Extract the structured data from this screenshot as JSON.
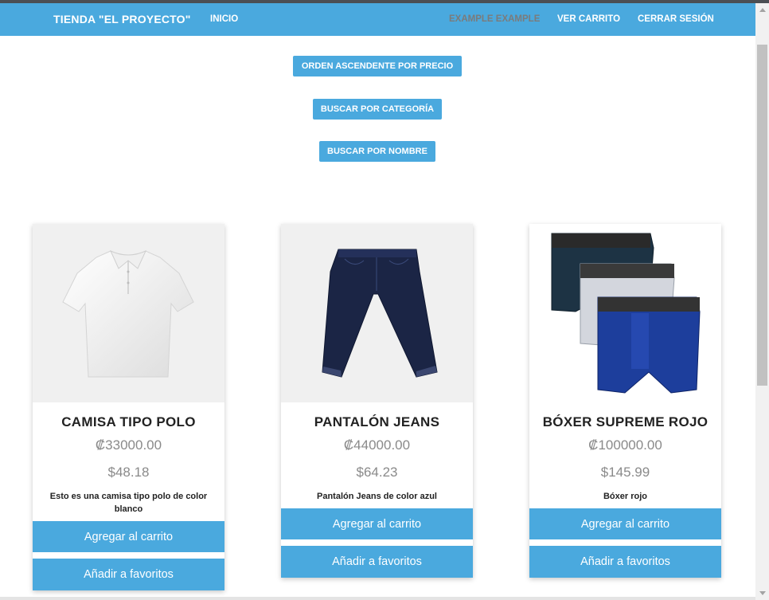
{
  "navbar": {
    "brand": "TIENDA \"EL PROYECTO\"",
    "home": "INICIO",
    "user": "EXAMPLE EXAMPLE",
    "cart": "VER CARRITO",
    "logout": "CERRAR SESIÓN",
    "color": "#4aa9de"
  },
  "actions": {
    "sort_price": "ORDEN ASCENDENTE POR PRECIO",
    "search_category": "BUSCAR POR CATEGORÍA",
    "search_name": "BUSCAR POR NOMBRE"
  },
  "products": [
    {
      "name": "CAMISA TIPO POLO",
      "price_crc": "₡33000.00",
      "price_usd": "$48.18",
      "description": "Esto es una camisa tipo polo de color blanco",
      "image_icon": "polo-shirt-icon",
      "add_label": "Agregar al carrito",
      "fav_label": "Añadir a favoritos"
    },
    {
      "name": "PANTALÓN JEANS",
      "price_crc": "₡44000.00",
      "price_usd": "$64.23",
      "description": "Pantalón Jeans de color azul",
      "image_icon": "jeans-icon",
      "add_label": "Agregar al carrito",
      "fav_label": "Añadir a favoritos"
    },
    {
      "name": "BÓXER SUPREME ROJO",
      "price_crc": "₡100000.00",
      "price_usd": "$145.99",
      "description": "Bóxer rojo",
      "image_icon": "boxer-briefs-icon",
      "add_label": "Agregar al carrito",
      "fav_label": "Añadir a favoritos"
    }
  ]
}
